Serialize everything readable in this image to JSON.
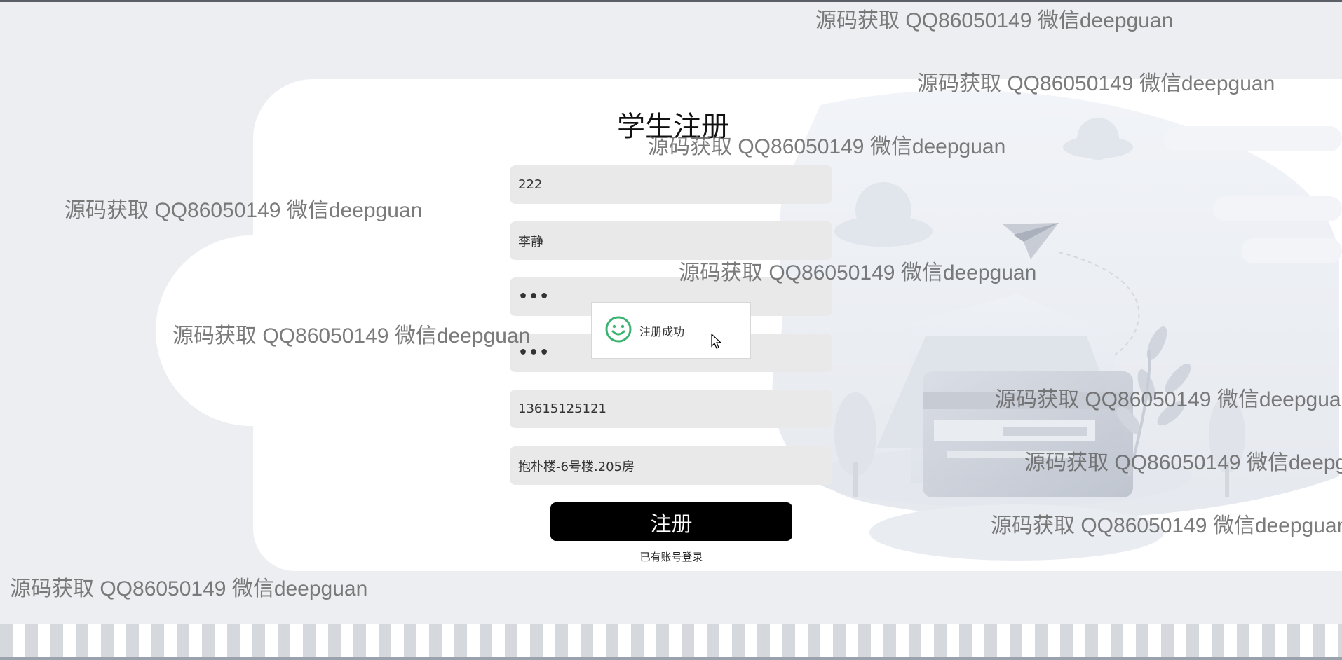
{
  "form": {
    "title": "学生注册",
    "fields": [
      {
        "name": "student-id-field",
        "value": "222",
        "type": "text"
      },
      {
        "name": "name-field",
        "value": "李静",
        "type": "text"
      },
      {
        "name": "password-field",
        "value": "•••",
        "type": "password"
      },
      {
        "name": "confirm-password-field",
        "value": "•••",
        "type": "password"
      },
      {
        "name": "phone-field",
        "value": "13615125121",
        "type": "text"
      },
      {
        "name": "dorm-field",
        "value": "抱朴楼-6号楼.205房",
        "type": "text"
      }
    ],
    "submit_label": "注册",
    "login_link": "已有账号登录"
  },
  "toast": {
    "icon": "smile-icon",
    "message": "注册成功",
    "color": "#3cb371"
  },
  "watermark": {
    "text": "源码获取 QQ86050149 微信deepguan"
  },
  "colors": {
    "page_bg": "#eceef1",
    "card_bg": "#ffffff",
    "field_bg": "#e9e9e9",
    "button_bg": "#000000",
    "button_text": "#ffffff"
  }
}
